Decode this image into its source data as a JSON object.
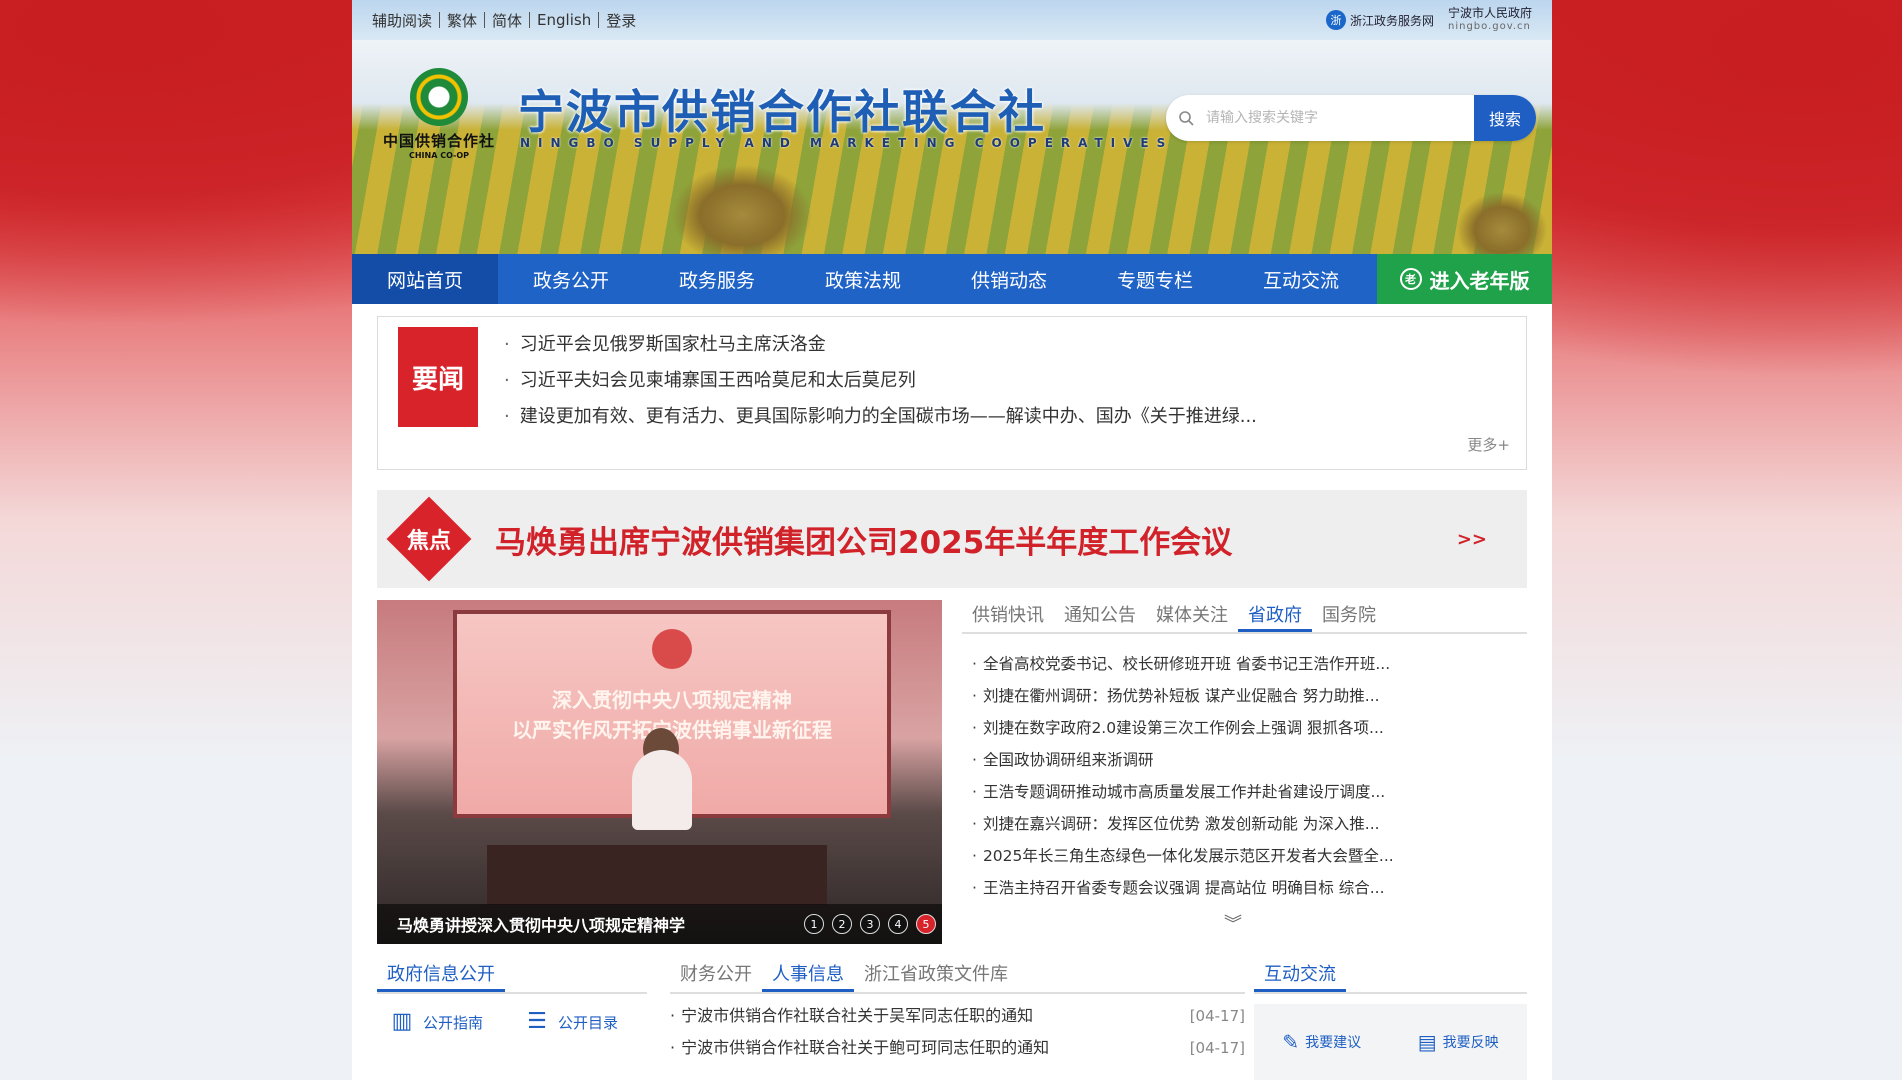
{
  "topbar": {
    "links": [
      "辅助阅读",
      "繁体",
      "简体",
      "English",
      "登录"
    ],
    "zj_service": "浙江政务服务网",
    "nb_gov": "宁波市人民政府",
    "nb_domain": "ningbo.gov.cn"
  },
  "banner": {
    "logo_cn": "中国供销合作社",
    "logo_en": "CHINA CO-OP",
    "title": "宁波市供销合作社联合社",
    "subtitle": "NINGBO SUPPLY AND MARKETING COOPERATIVES",
    "search_placeholder": "请输入搜索关键字",
    "search_button": "搜索"
  },
  "nav": {
    "items": [
      "网站首页",
      "政务公开",
      "政务服务",
      "政策法规",
      "供销动态",
      "专题专栏",
      "互动交流"
    ],
    "elder": "进入老年版"
  },
  "headline": {
    "badge": "要闻",
    "items": [
      "习近平会见俄罗斯国家杜马主席沃洛金",
      "习近平夫妇会见柬埔寨国王西哈莫尼和太后莫尼列",
      "建设更加有效、更有活力、更具国际影响力的全国碳市场——解读中办、国办《关于推进绿..."
    ],
    "more": "更多+"
  },
  "focus": {
    "badge": "焦点",
    "title": "马焕勇出席宁波供销集团公司2025年半年度工作会议",
    "more": ">>"
  },
  "slider": {
    "screen_line1": "深入贯彻中央八项规定精神",
    "screen_line2": "以严实作风开拓宁波供销事业新征程",
    "caption": "马焕勇讲授深入贯彻中央八项规定精神学",
    "dots": [
      "1",
      "2",
      "3",
      "4",
      "5"
    ],
    "active_dot": 5
  },
  "news_tabs": {
    "tabs": [
      "供销快讯",
      "通知公告",
      "媒体关注",
      "省政府",
      "国务院"
    ],
    "active": "省政府",
    "items": [
      "全省高校党委书记、校长研修班开班 省委书记王浩作开班...",
      "刘捷在衢州调研：扬优势补短板 谋产业促融合 努力助推...",
      "刘捷在数字政府2.0建设第三次工作例会上强调 狠抓各项...",
      "全国政协调研组来浙调研",
      "王浩专题调研推动城市高质量发展工作并赴省建设厅调度...",
      "刘捷在嘉兴调研：发挥区位优势 激发创新动能 为深入推...",
      "2025年长三角生态绿色一体化发展示范区开发者大会暨全...",
      "王浩主持召开省委专题会议强调 提高站位 明确目标 综合..."
    ]
  },
  "gov_open": {
    "title": "政府信息公开",
    "links": [
      "公开指南",
      "公开目录"
    ]
  },
  "personnel": {
    "tabs": [
      "财务公开",
      "人事信息",
      "浙江省政策文件库"
    ],
    "active": "人事信息",
    "items": [
      {
        "title": "宁波市供销合作社联合社关于吴军同志任职的通知",
        "date": "[04-17]"
      },
      {
        "title": "宁波市供销合作社联合社关于鲍可珂同志任职的通知",
        "date": "[04-17]"
      }
    ]
  },
  "interact": {
    "title": "互动交流",
    "suggest": "我要建议",
    "feedback": "我要反映"
  }
}
